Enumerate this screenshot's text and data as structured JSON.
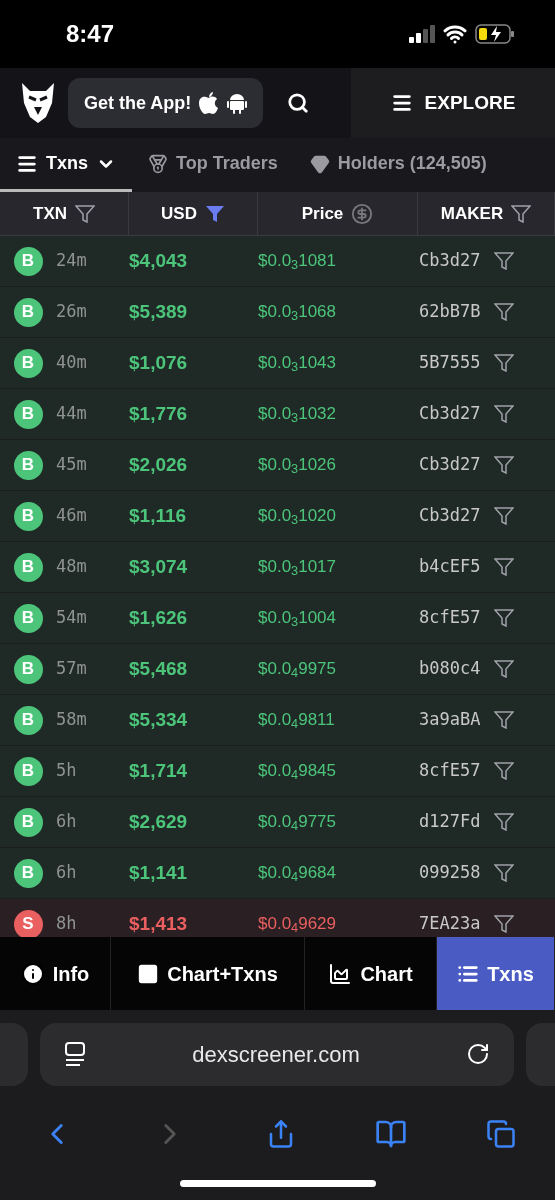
{
  "status_bar": {
    "time": "8:47"
  },
  "header": {
    "get_app": "Get the App!",
    "explore": "EXPLORE"
  },
  "tabs": [
    {
      "label": "Txns",
      "kind": "menu",
      "selected": true
    },
    {
      "label": "Top Traders",
      "kind": "medal",
      "selected": false
    },
    {
      "label": "Holders (124,505)",
      "kind": "diamond",
      "selected": false
    }
  ],
  "columns": [
    {
      "label": "TXN",
      "kind": "filter",
      "filter_active": false
    },
    {
      "label": "USD",
      "kind": "filter",
      "filter_active": true
    },
    {
      "label": "Price",
      "kind": "currency",
      "filter_active": false
    },
    {
      "label": "MAKER",
      "kind": "filter",
      "filter_active": false
    }
  ],
  "rows": [
    {
      "kind": "buy",
      "type": "B",
      "age": "24m",
      "usd": "$4,043",
      "price": "$0.0$_{3}$1081",
      "maker": "Cb3d27"
    },
    {
      "kind": "buy",
      "type": "B",
      "age": "26m",
      "usd": "$5,389",
      "price": "$0.0$_{3}$1068",
      "maker": "62bB7B"
    },
    {
      "kind": "buy",
      "type": "B",
      "age": "40m",
      "usd": "$1,076",
      "price": "$0.0$_{3}$1043",
      "maker": "5B7555"
    },
    {
      "kind": "buy",
      "type": "B",
      "age": "44m",
      "usd": "$1,776",
      "price": "$0.0$_{3}$1032",
      "maker": "Cb3d27"
    },
    {
      "kind": "buy",
      "type": "B",
      "age": "45m",
      "usd": "$2,026",
      "price": "$0.0$_{3}$1026",
      "maker": "Cb3d27"
    },
    {
      "kind": "buy",
      "type": "B",
      "age": "46m",
      "usd": "$1,116",
      "price": "$0.0$_{3}$1020",
      "maker": "Cb3d27"
    },
    {
      "kind": "buy",
      "type": "B",
      "age": "48m",
      "usd": "$3,074",
      "price": "$0.0$_{3}$1017",
      "maker": "b4cEF5"
    },
    {
      "kind": "buy",
      "type": "B",
      "age": "54m",
      "usd": "$1,626",
      "price": "$0.0$_{3}$1004",
      "maker": "8cfE57"
    },
    {
      "kind": "buy",
      "type": "B",
      "age": "57m",
      "usd": "$5,468",
      "price": "$0.0$_{4}$9975",
      "maker": "b080c4"
    },
    {
      "kind": "buy",
      "type": "B",
      "age": "58m",
      "usd": "$5,334",
      "price": "$0.0$_{4}$9811",
      "maker": "3a9aBA"
    },
    {
      "kind": "buy",
      "type": "B",
      "age": "5h",
      "usd": "$1,714",
      "price": "$0.0$_{4}$9845",
      "maker": "8cfE57"
    },
    {
      "kind": "buy",
      "type": "B",
      "age": "6h",
      "usd": "$2,629",
      "price": "$0.0$_{4}$9775",
      "maker": "d127Fd"
    },
    {
      "kind": "buy",
      "type": "B",
      "age": "6h",
      "usd": "$1,141",
      "price": "$0.0$_{4}$9684",
      "maker": "099258"
    },
    {
      "kind": "sell",
      "type": "S",
      "age": "8h",
      "usd": "$1,413",
      "price": "$0.0$_{4}$9629",
      "maker": "7EA23a"
    }
  ],
  "bottom_nav": [
    {
      "label": "Info",
      "kind": "info",
      "selected": false
    },
    {
      "label": "Chart+Txns",
      "kind": "split",
      "selected": false
    },
    {
      "label": "Chart",
      "kind": "chart",
      "selected": false
    },
    {
      "label": "Txns",
      "kind": "list",
      "selected": true
    }
  ],
  "browser": {
    "url": "dexscreener.com"
  }
}
